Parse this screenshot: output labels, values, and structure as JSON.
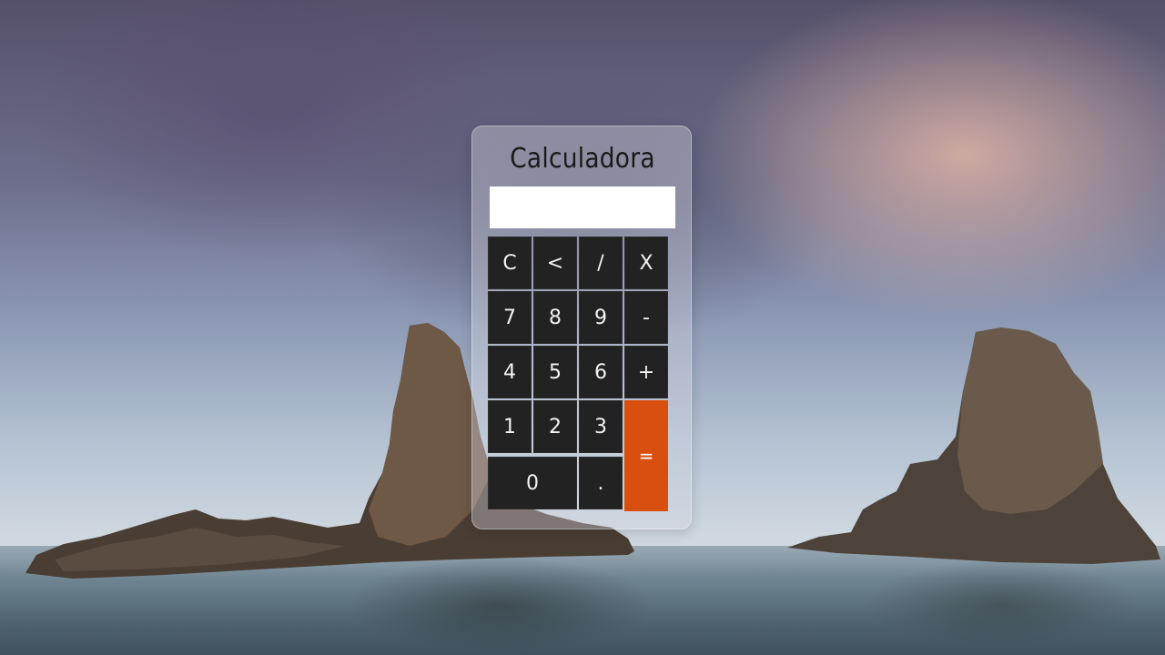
{
  "app": {
    "title": "Calculadora"
  },
  "display": {
    "value": ""
  },
  "keys": {
    "clear": "C",
    "backspace": "<",
    "divide": "/",
    "multiply": "X",
    "seven": "7",
    "eight": "8",
    "nine": "9",
    "subtract": "-",
    "four": "4",
    "five": "5",
    "six": "6",
    "add": "+",
    "one": "1",
    "two": "2",
    "three": "3",
    "equals": "=",
    "zero": "0",
    "decimal": "."
  },
  "colors": {
    "key_background": "#222222",
    "key_text": "#f2f2f2",
    "equals_background": "#d94f0f",
    "display_background": "#ffffff"
  }
}
